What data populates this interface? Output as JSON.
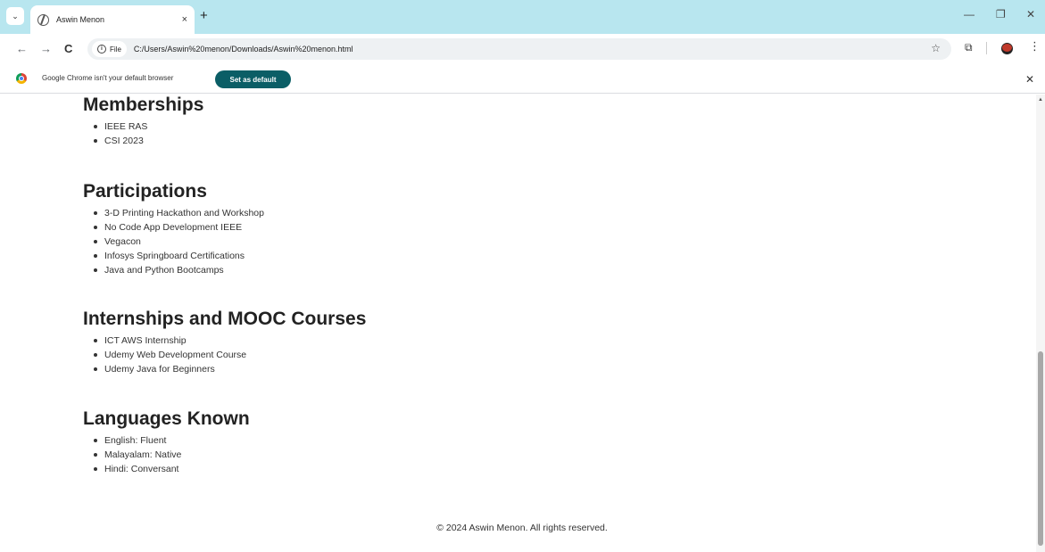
{
  "browser": {
    "tab_title": "Aswin Menon",
    "tab_close": "×",
    "new_tab": "+",
    "url_chip": "File",
    "url": "C:/Users/Aswin%20menon/Downloads/Aswin%20menon.html",
    "window_controls": {
      "minimize": "—",
      "restore": "❐",
      "close": "✕"
    }
  },
  "infobar": {
    "message": "Google Chrome isn't your default browser",
    "button_label": "Set as default",
    "close": "✕"
  },
  "page": {
    "sections": [
      {
        "title": "Memberships",
        "items": [
          "IEEE RAS",
          "CSI 2023"
        ]
      },
      {
        "title": "Participations",
        "items": [
          "3-D Printing Hackathon and Workshop",
          "No Code App Development IEEE",
          "Vegacon",
          "Infosys Springboard Certifications",
          "Java and Python Bootcamps"
        ]
      },
      {
        "title": "Internships and MOOC Courses",
        "items": [
          "ICT AWS Internship",
          "Udemy Web Development Course",
          "Udemy Java for Beginners"
        ]
      },
      {
        "title": "Languages Known",
        "items": [
          "English: Fluent",
          "Malayalam: Native",
          "Hindi: Conversant"
        ]
      }
    ],
    "footer": "© 2024 Aswin Menon. All rights reserved."
  },
  "colors": {
    "tabstrip": "#b8e6ef",
    "accent_button": "#0b5e66"
  }
}
